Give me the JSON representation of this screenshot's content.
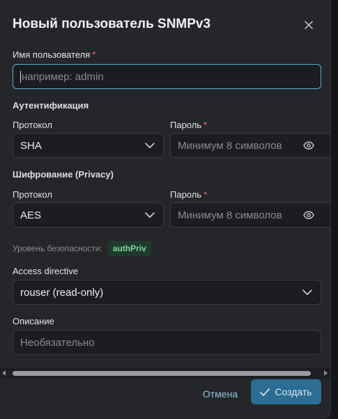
{
  "dialog": {
    "title": "Новый пользователь SNMPv3",
    "close_icon": "close-icon"
  },
  "username": {
    "label": "Имя пользователя",
    "required_mark": "*",
    "placeholder": "например: admin"
  },
  "authentication": {
    "section_title": "Аутентификация",
    "protocol_label": "Протокол",
    "protocol_value": "SHA",
    "password_label": "Пароль",
    "password_required": "*",
    "password_placeholder": "Минимум 8 символов"
  },
  "privacy": {
    "section_title": "Шифрование (Privacy)",
    "protocol_label": "Протокол",
    "protocol_value": "AES",
    "password_label": "Пароль",
    "password_required": "*",
    "password_placeholder": "Минимум 8 символов"
  },
  "security_level": {
    "label": "Уровень безопасности:",
    "value": "authPriv"
  },
  "access_directive": {
    "label": "Access directive",
    "value": "rouser (read-only)"
  },
  "description": {
    "label": "Описание",
    "placeholder": "Необязательно"
  },
  "footer": {
    "cancel_label": "Отмена",
    "create_label": "Создать"
  },
  "colors": {
    "accent": "#2b6d93",
    "focus_border": "#5fb0d0",
    "required": "#ff6b6b",
    "badge_text": "#7fd6a3",
    "badge_bg": "#1f3a2c"
  }
}
